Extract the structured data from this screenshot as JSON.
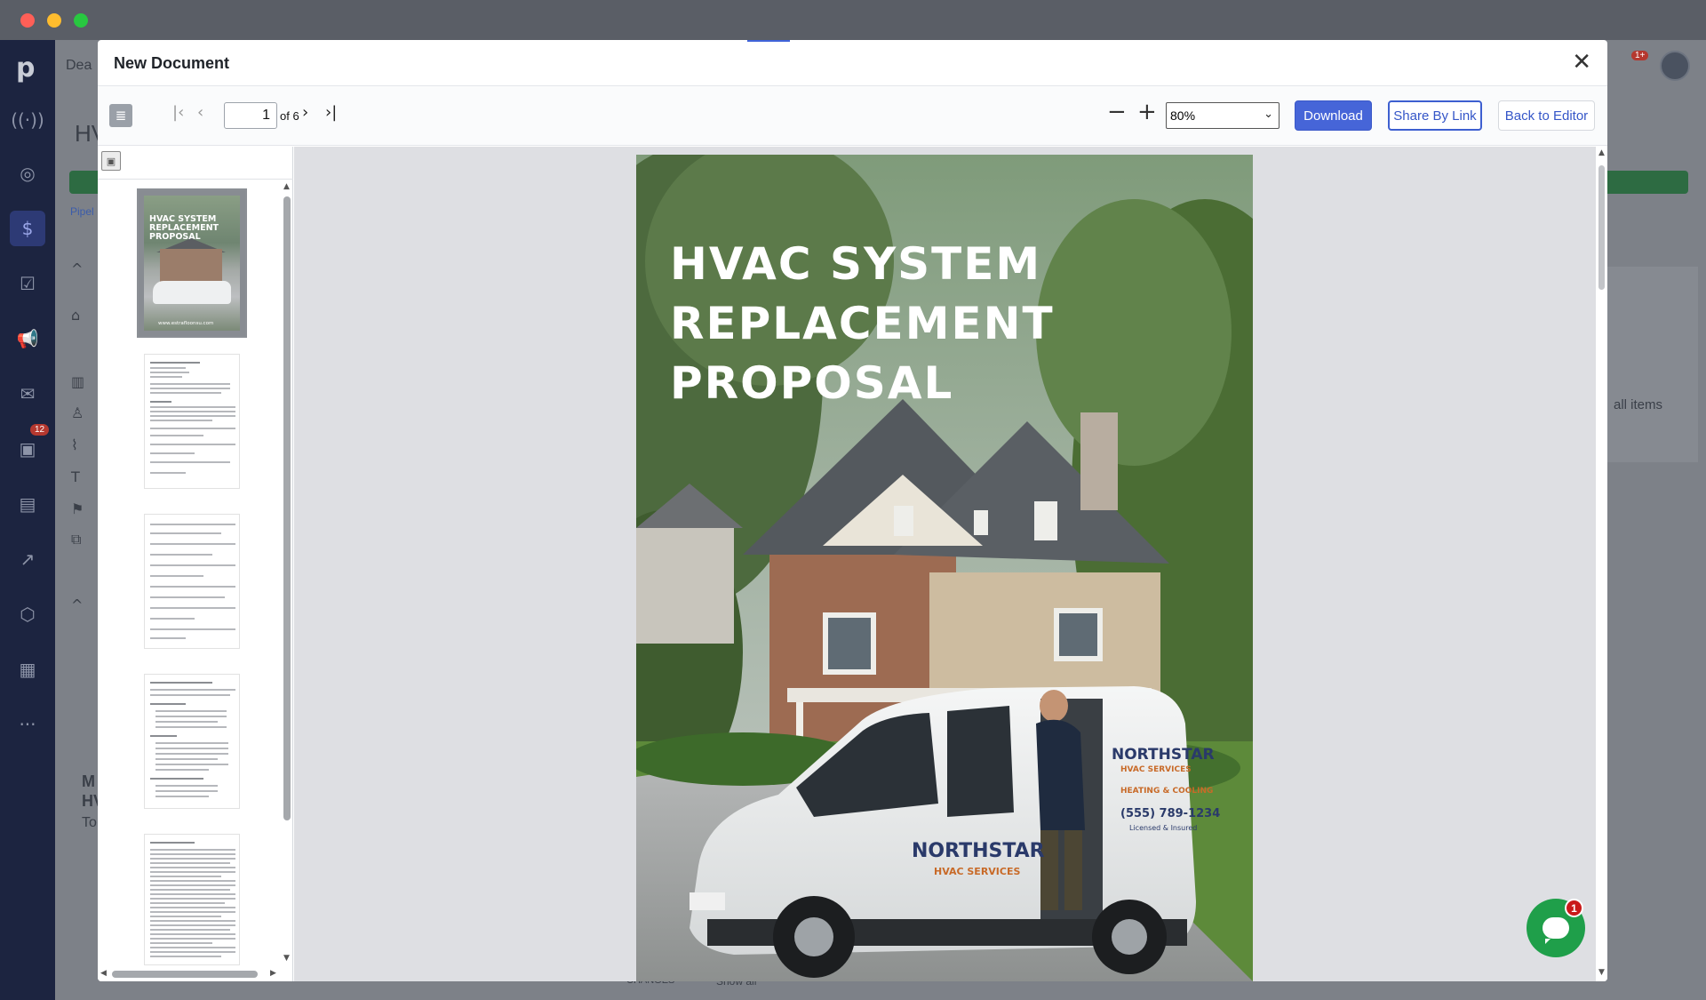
{
  "window": {
    "title": ""
  },
  "background": {
    "nav_badge": "12",
    "partial_title": "Dea",
    "partial_heading": "HV",
    "partial_link": "Pipel",
    "right_text": "all items",
    "bottom_link": "Show all",
    "bottom_chip": "CHANGES",
    "left_partial_1": "M",
    "left_partial_2": "HV",
    "left_partial_3": "To",
    "top_badge": "1+"
  },
  "modal": {
    "title": "New Document",
    "close_icon": "close-icon"
  },
  "toolbar": {
    "page_current": "1",
    "page_total_label": "of 6",
    "zoom_value": "80%",
    "download_label": "Download",
    "share_label": "Share By Link",
    "back_label": "Back to Editor"
  },
  "thumbnails": {
    "cover": {
      "title": "HVAC SYSTEM REPLACEMENT PROPOSAL",
      "url": "www.estrafloonsu.com"
    }
  },
  "document": {
    "title_line1": "HVAC SYSTEM",
    "title_line2": "REPLACEMENT",
    "title_line3": "PROPOSAL",
    "brand_name": "NORTHSTAR",
    "brand_sub": "HVAC SERVICES",
    "brand_tagline": "HEATING & COOLING",
    "phone": "(555) 789-1234",
    "licensed": "Licensed & Insured"
  },
  "chat": {
    "badge": "1"
  },
  "colors": {
    "accent": "#4665d8",
    "nav_bg": "#1c2440",
    "chat": "#1f9f4a",
    "badge": "#c91a1a"
  }
}
